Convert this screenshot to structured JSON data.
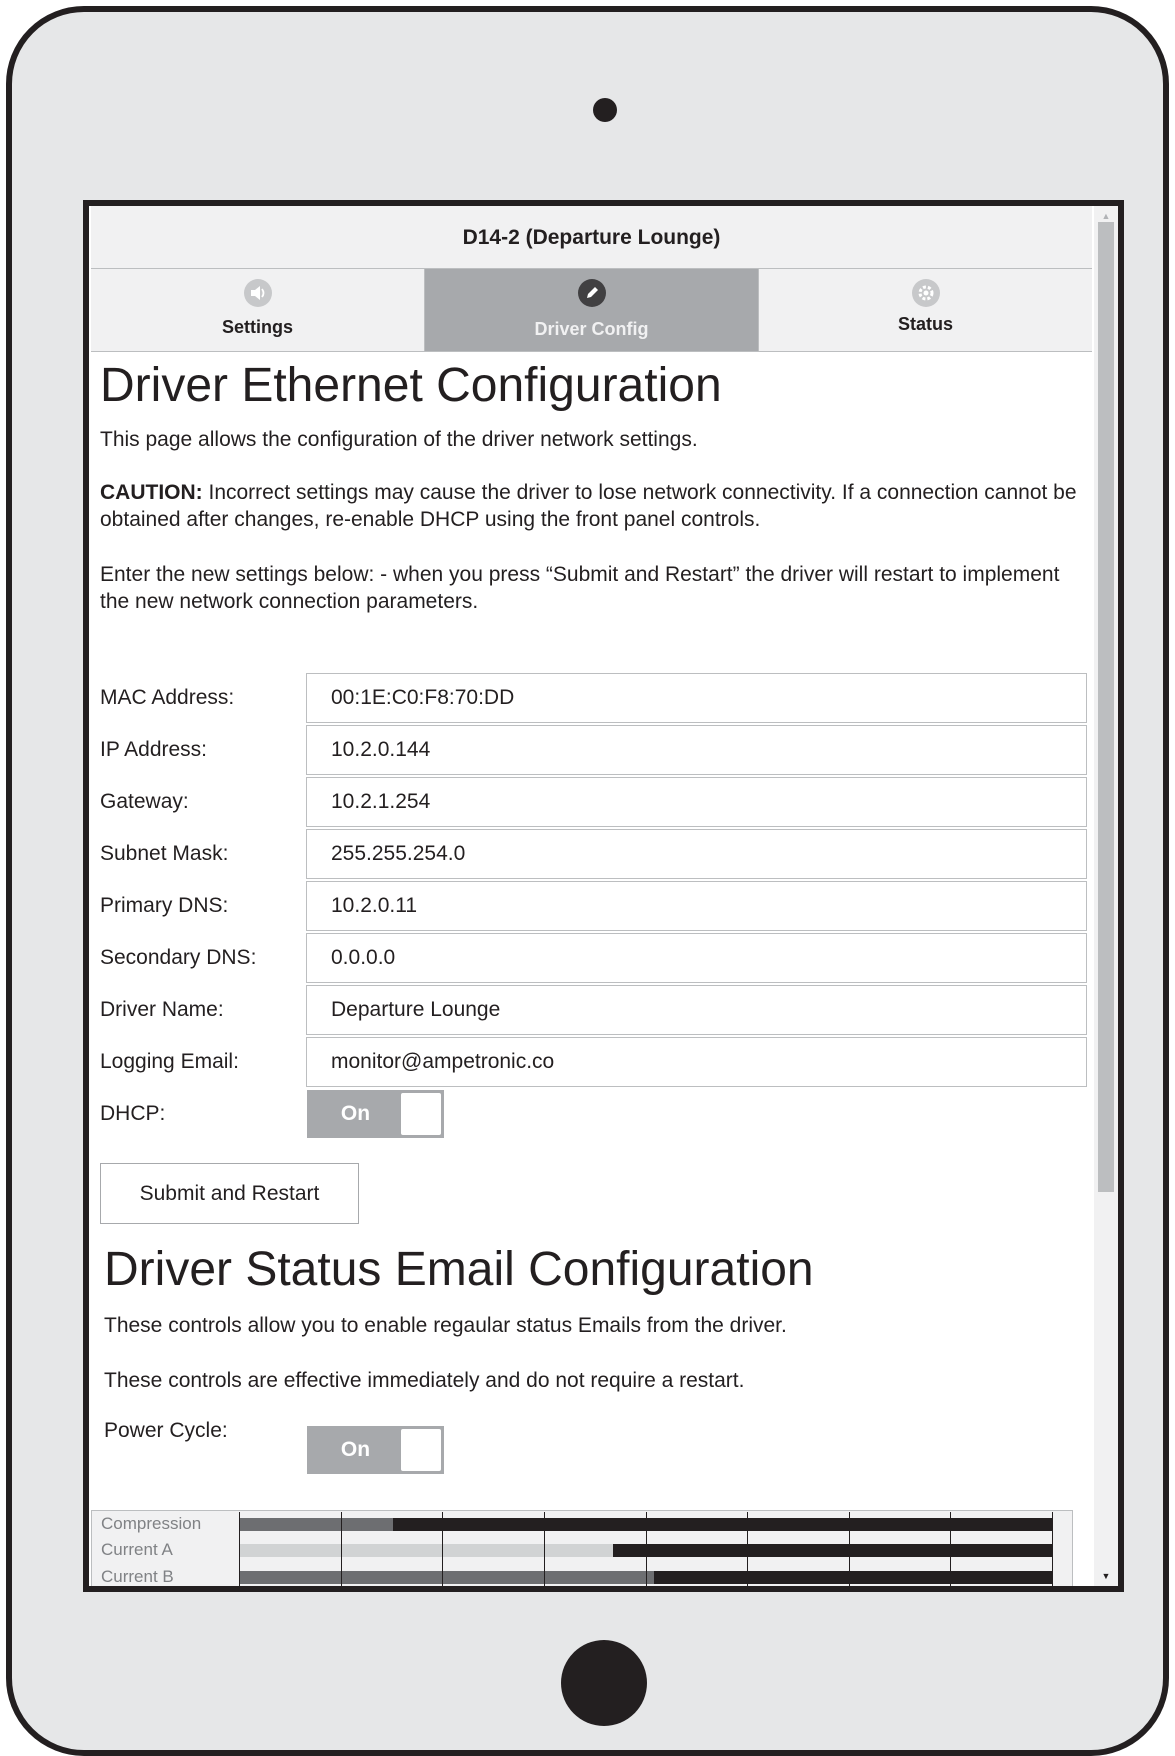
{
  "colors": {
    "device_frame": "#231f20",
    "device_body": "#e6e7e8",
    "tab_active": "#a7a9ac",
    "toggle_on": "#a7a9ac",
    "meter_track": "#231f20"
  },
  "header": {
    "title": "D14-2 (Departure Lounge)"
  },
  "tabs": [
    {
      "label": "Settings",
      "icon": "speaker-icon",
      "active": false
    },
    {
      "label": "Driver Config",
      "icon": "pencil-icon",
      "active": true
    },
    {
      "label": "Status",
      "icon": "gear-icon",
      "active": false
    }
  ],
  "ethernet": {
    "heading": "Driver Ethernet Configuration",
    "intro": "This page allows the configuration of the driver network settings.",
    "caution_label": "CAUTION:",
    "caution_text": " Incorrect settings may cause the driver to lose network connectivity. If a connection cannot be obtained after changes, re-enable DHCP using the front panel controls.",
    "instructions": "Enter the new settings below: - when you press “Submit and Restart” the driver will restart to implement the new network connection parameters.",
    "fields": [
      {
        "label": "MAC Address:",
        "value": "00:1E:C0:F8:70:DD"
      },
      {
        "label": "IP Address:",
        "value": "10.2.0.144"
      },
      {
        "label": "Gateway:",
        "value": "10.2.1.254"
      },
      {
        "label": "Subnet Mask:",
        "value": "255.255.254.0"
      },
      {
        "label": "Primary DNS:",
        "value": "10.2.0.11"
      },
      {
        "label": "Secondary DNS:",
        "value": "0.0.0.0"
      },
      {
        "label": "Driver Name:",
        "value": "Departure Lounge"
      },
      {
        "label": "Logging Email:",
        "value": "monitor@ampetronic.co"
      }
    ],
    "dhcp": {
      "label": "DHCP:",
      "state": "On"
    },
    "submit_label": "Submit and Restart"
  },
  "email_config": {
    "heading": "Driver Status Email Configuration",
    "text1": "These controls allow you to enable regaular status Emails from the driver.",
    "text2": "These controls are effective immediately and do not require a restart.",
    "power_cycle": {
      "label": "Power Cycle:",
      "state": "On"
    }
  },
  "meters": [
    {
      "label": "Compression",
      "level": 0.19,
      "color": "#6d6e71"
    },
    {
      "label": "Current A",
      "level": 0.46,
      "color": "#d1d3d4"
    },
    {
      "label": "Current B",
      "level": 0.51,
      "color": "#6d6e71"
    }
  ]
}
